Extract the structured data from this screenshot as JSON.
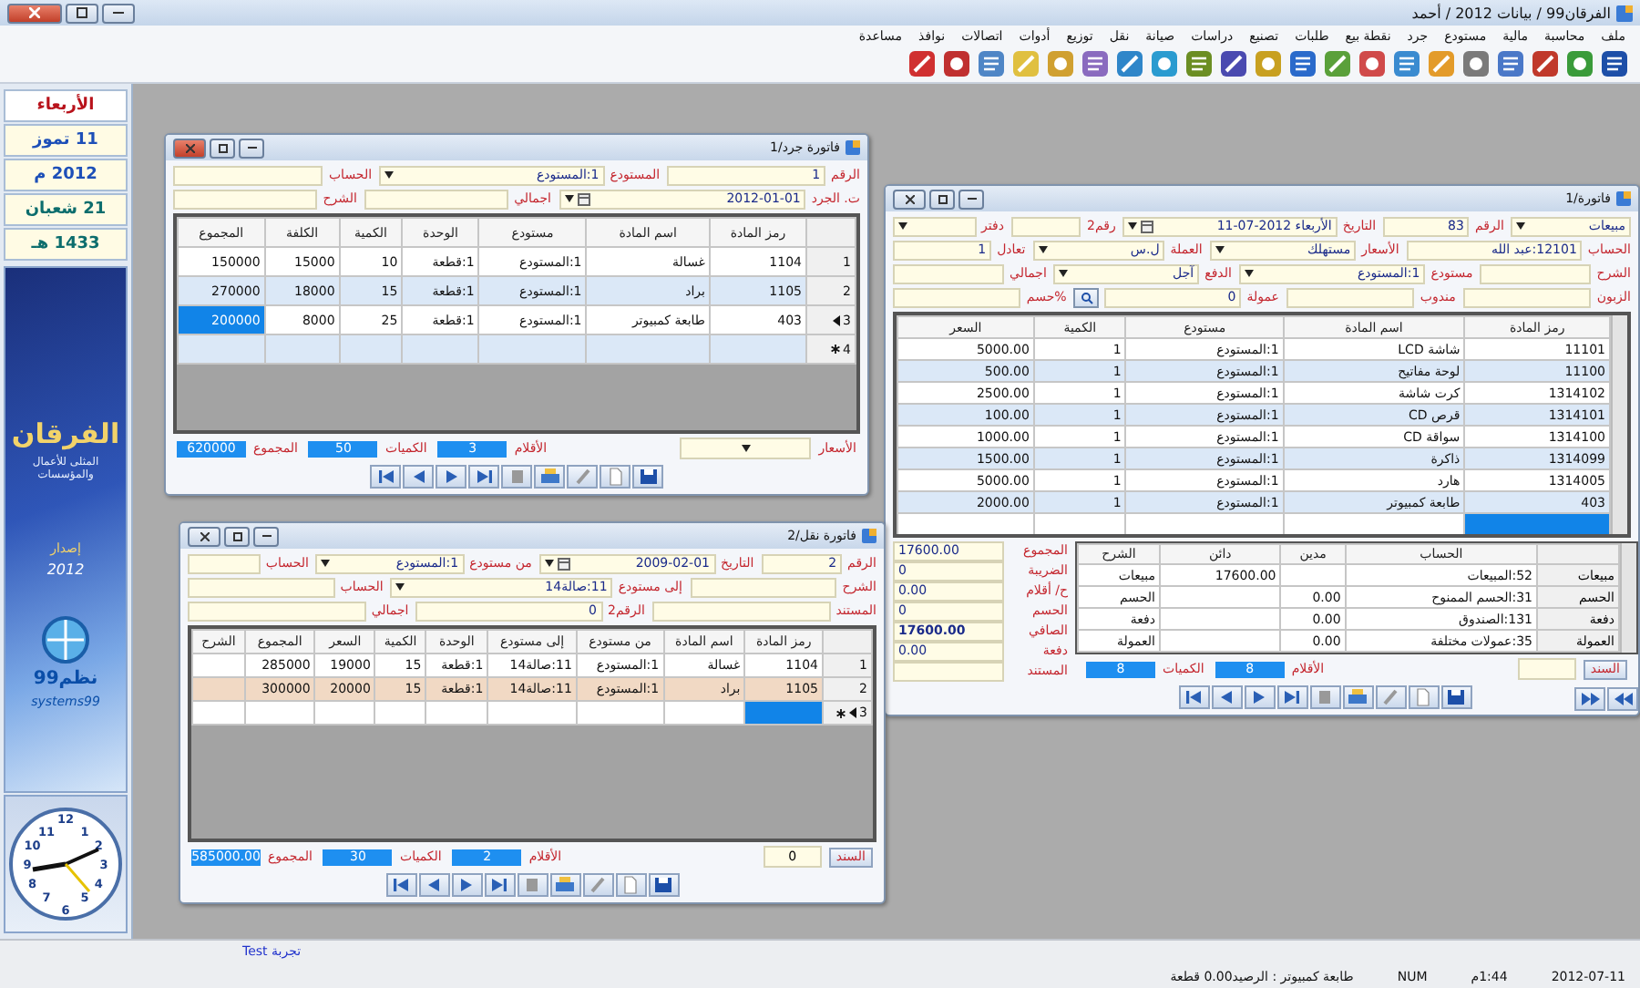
{
  "window": {
    "title": "الفرقان99 / بيانات 2012 / أحمد"
  },
  "menu": [
    "ملف",
    "محاسبة",
    "مالية",
    "مستودع",
    "جرد",
    "نقطة بيع",
    "طلبات",
    "تصنيع",
    "دراسات",
    "صيانة",
    "نقل",
    "توزيع",
    "أدوات",
    "اتصالات",
    "نوافذ",
    "مساعدة"
  ],
  "sidebar": {
    "dates": [
      {
        "text": "الأربعاء",
        "kind": "day"
      },
      {
        "text": "11 تموز",
        "kind": "gregorian"
      },
      {
        "text": "2012 م",
        "kind": "gregorian"
      },
      {
        "text": "21 شعبان",
        "kind": "hijri"
      },
      {
        "text": "1433 هـ",
        "kind": "hijri"
      }
    ],
    "banner": {
      "logo": "الفرقان",
      "tagline": "المثلى للأعمال والمؤسسات",
      "edition": "إصدار",
      "year": "2012",
      "brand": "نظم99",
      "brand_latin": "systems99"
    },
    "clock": {
      "numerals": [
        "12",
        "11",
        "1",
        "10",
        "2",
        "9",
        "3",
        "8",
        "4",
        "7",
        "5",
        "6"
      ]
    }
  },
  "windows": [
    {
      "kind": "inventory",
      "title": "فاتورة جرد/1",
      "fields": [
        [
          {
            "label": "الرقم",
            "value": "1",
            "kind": "text"
          },
          {
            "label": "المستودع",
            "value": "1:المستودع",
            "kind": "dropdown"
          },
          {
            "label": "الحساب",
            "kind": "text"
          }
        ],
        [
          {
            "label": "ت. الجرد",
            "value": "2012-01-01",
            "kind": "date"
          },
          {
            "label": "اجمالي",
            "kind": "text"
          },
          {
            "label": "الشرح",
            "kind": "text"
          }
        ]
      ],
      "grid": {
        "columns": [
          "رمز المادة",
          "اسم المادة",
          "مستودع",
          "الوحدة",
          "الكمية",
          "الكلفة",
          "المجموع"
        ],
        "rows": [
          {
            "number": "1",
            "cells": [
              "1104",
              "غسالة",
              "1:المستودع",
              "1:قطعة",
              "10",
              "15000",
              "150000"
            ],
            "selected": false,
            "pointer": false,
            "new_row": false
          },
          {
            "number": "2",
            "cells": [
              "1105",
              "براد",
              "1:المستودع",
              "1:قطعة",
              "15",
              "18000",
              "270000"
            ],
            "selected": false,
            "pointer": false,
            "new_row": false
          },
          {
            "number": "3",
            "cells": [
              "403",
              "طابعة كمبيوتر",
              "1:المستودع",
              "1:قطعة",
              "25",
              "8000",
              {
                "text": "200000",
                "focused": true
              }
            ],
            "selected": false,
            "pointer": true,
            "new_row": false
          },
          {
            "number": "4",
            "selected": false,
            "pointer": false,
            "new_row": true
          }
        ]
      },
      "footer": {
        "prices": {
          "label": "الأسعار"
        },
        "totals": [
          {
            "label": "الأقلام",
            "value": "3"
          },
          {
            "label": "الكميات",
            "value": "50"
          },
          {
            "label": "المجموع",
            "value": "620000"
          }
        ]
      }
    },
    {
      "kind": "sales",
      "title": "فاتورة/1",
      "fields": [
        [
          {
            "value": "مبيعات",
            "kind": "dropdown"
          },
          {
            "label": "الرقم",
            "value": "83",
            "kind": "text"
          },
          {
            "label": "التاريخ",
            "value": "الأربعاء 2012-07-11",
            "kind": "date"
          },
          {
            "label": "رقم2",
            "kind": "text"
          },
          {
            "label": "دفتر",
            "kind": "dropdown"
          }
        ],
        [
          {
            "label": "الحساب",
            "value": "12101:عبد الله",
            "kind": "text"
          },
          {
            "label": "الأسعار",
            "value": "مستهلك",
            "kind": "dropdown"
          },
          {
            "label": "العملة",
            "value": "ل.س",
            "kind": "dropdown"
          },
          {
            "label": "تعادل",
            "value": "1",
            "kind": "text"
          }
        ],
        [
          {
            "label": "الشرح",
            "kind": "text"
          },
          {
            "label": "مستودع",
            "value": "1:المستودع",
            "kind": "dropdown"
          },
          {
            "label": "الدفع",
            "value": "آجل",
            "kind": "dropdown"
          },
          {
            "label": "اجمالي",
            "kind": "text"
          }
        ],
        [
          {
            "label": "الزبون",
            "kind": "text"
          },
          {
            "label": "مندوب",
            "kind": "text"
          },
          {
            "label": "عمولة",
            "value": "0",
            "kind": "lookup"
          },
          {
            "label": "%حسم",
            "kind": "text"
          }
        ]
      ],
      "grid": {
        "columns": [
          "رمز المادة",
          "اسم المادة",
          "مستودع",
          "الكمية",
          "السعر"
        ],
        "rows": [
          {
            "cells": [
              "11101",
              "شاشة LCD",
              "1:المستودع",
              "1",
              "5000.00"
            ],
            "selected": false
          },
          {
            "cells": [
              "11100",
              "لوحة مفاتيح",
              "1:المستودع",
              "1",
              "500.00"
            ],
            "selected": false
          },
          {
            "cells": [
              "1314102",
              "كرت شاشة",
              "1:المستودع",
              "1",
              "2500.00"
            ],
            "selected": false
          },
          {
            "cells": [
              "1314101",
              "قرص CD",
              "1:المستودع",
              "1",
              "100.00"
            ],
            "selected": false
          },
          {
            "cells": [
              "1314100",
              "سواقة CD",
              "1:المستودع",
              "1",
              "1000.00"
            ],
            "selected": false
          },
          {
            "cells": [
              "1314099",
              "ذاكرة",
              "1:المستودع",
              "1",
              "1500.00"
            ],
            "selected": false
          },
          {
            "cells": [
              "1314005",
              "هارد",
              "1:المستودع",
              "1",
              "5000.00"
            ],
            "selected": false
          },
          {
            "cells": [
              "403",
              "طابعة كمبيوتر",
              "1:المستودع",
              "1",
              "2000.00"
            ],
            "selected": false
          },
          {
            "cells": [
              {
                "focused": true
              }
            ],
            "selected": false
          }
        ]
      },
      "entries": {
        "columns": [
          "الحساب",
          "مدين",
          "دائن",
          "الشرح"
        ],
        "rows": [
          {
            "side": "مبيعات",
            "cells": [
              "52:المبيعات",
              null,
              "17600.00",
              "مبيعات"
            ]
          },
          {
            "side": "الحسم",
            "cells": [
              "31:الحسم الممنوح",
              "0.00",
              null,
              "الحسم"
            ]
          },
          {
            "side": "دفعة",
            "cells": [
              "131:الصندوق",
              "0.00",
              null,
              "دفعة"
            ]
          },
          {
            "side": "العمولة",
            "cells": [
              "35:عمولات مختلفة",
              "0.00",
              null,
              "العمولة"
            ]
          }
        ]
      },
      "summary": [
        {
          "label": "المجموع",
          "value": "17600.00"
        },
        {
          "label": "الضريبة",
          "value": "0"
        },
        {
          "label": "ح/ أقلام",
          "value": "0.00"
        },
        {
          "label": "الحسم",
          "value": "0"
        },
        {
          "label": "الصافي",
          "value": "17600.00",
          "emphasis": true
        },
        {
          "label": "دفعة",
          "value": "0.00"
        },
        {
          "label": "المستند"
        }
      ],
      "record_nav": true,
      "footer": {
        "voucher": {
          "button": "السند"
        },
        "totals": [
          {
            "label": "الأقلام",
            "value": "8"
          },
          {
            "label": "الكميات",
            "value": "8"
          }
        ]
      }
    },
    {
      "kind": "transfer",
      "title": "فاتورة نقل/2",
      "fields": [
        [
          {
            "label": "الرقم",
            "value": "2",
            "kind": "text"
          },
          {
            "label": "التاريخ",
            "value": "2009-02-01",
            "kind": "date"
          },
          {
            "label": "من مستودع",
            "value": "1:المستودع",
            "kind": "dropdown"
          },
          {
            "label": "الحساب",
            "kind": "text"
          }
        ],
        [
          {
            "label": "الشرح",
            "kind": "text"
          },
          {
            "label": "إلى مستودع",
            "value": "11:صالة14",
            "kind": "dropdown"
          },
          {
            "label": "الحساب",
            "kind": "text"
          }
        ],
        [
          {
            "label": "المستند",
            "kind": "text"
          },
          {
            "label": "الرقم2",
            "value": "0",
            "kind": "text"
          },
          {
            "label": "اجمالي",
            "kind": "text"
          }
        ]
      ],
      "grid": {
        "columns": [
          "رمز المادة",
          "اسم المادة",
          "من مستودع",
          "إلى مستودع",
          "الوحدة",
          "الكمية",
          "السعر",
          "المجموع",
          "الشرح"
        ],
        "rows": [
          {
            "number": "1",
            "cells": [
              "1104",
              "غسالة",
              "1:المستودع",
              "11:صالة14",
              "1:قطعة",
              "15",
              "19000",
              "285000"
            ],
            "selected": false,
            "pointer": false,
            "new_row": false
          },
          {
            "number": "2",
            "cells": [
              "1105",
              "براد",
              "1:المستودع",
              "11:صالة14",
              "1:قطعة",
              "15",
              "20000",
              "300000"
            ],
            "selected": true,
            "pointer": false,
            "new_row": false
          },
          {
            "number": "3",
            "cells": [
              {
                "focused": true
              }
            ],
            "selected": false,
            "pointer": true,
            "new_row": true
          }
        ]
      },
      "footer": {
        "voucher": {
          "button": "السند",
          "value": "0"
        },
        "totals": [
          {
            "label": "الأقلام",
            "value": "2"
          },
          {
            "label": "الكميات",
            "value": "30"
          },
          {
            "label": "المجموع",
            "value": "585000.00"
          }
        ]
      }
    }
  ],
  "status_bar": {
    "user": "تجربة Test",
    "items": [
      "2012-07-11",
      "1:44م",
      "NUM",
      "طابعة كمبيوتر : الرصيد0.00 قطعة"
    ]
  }
}
